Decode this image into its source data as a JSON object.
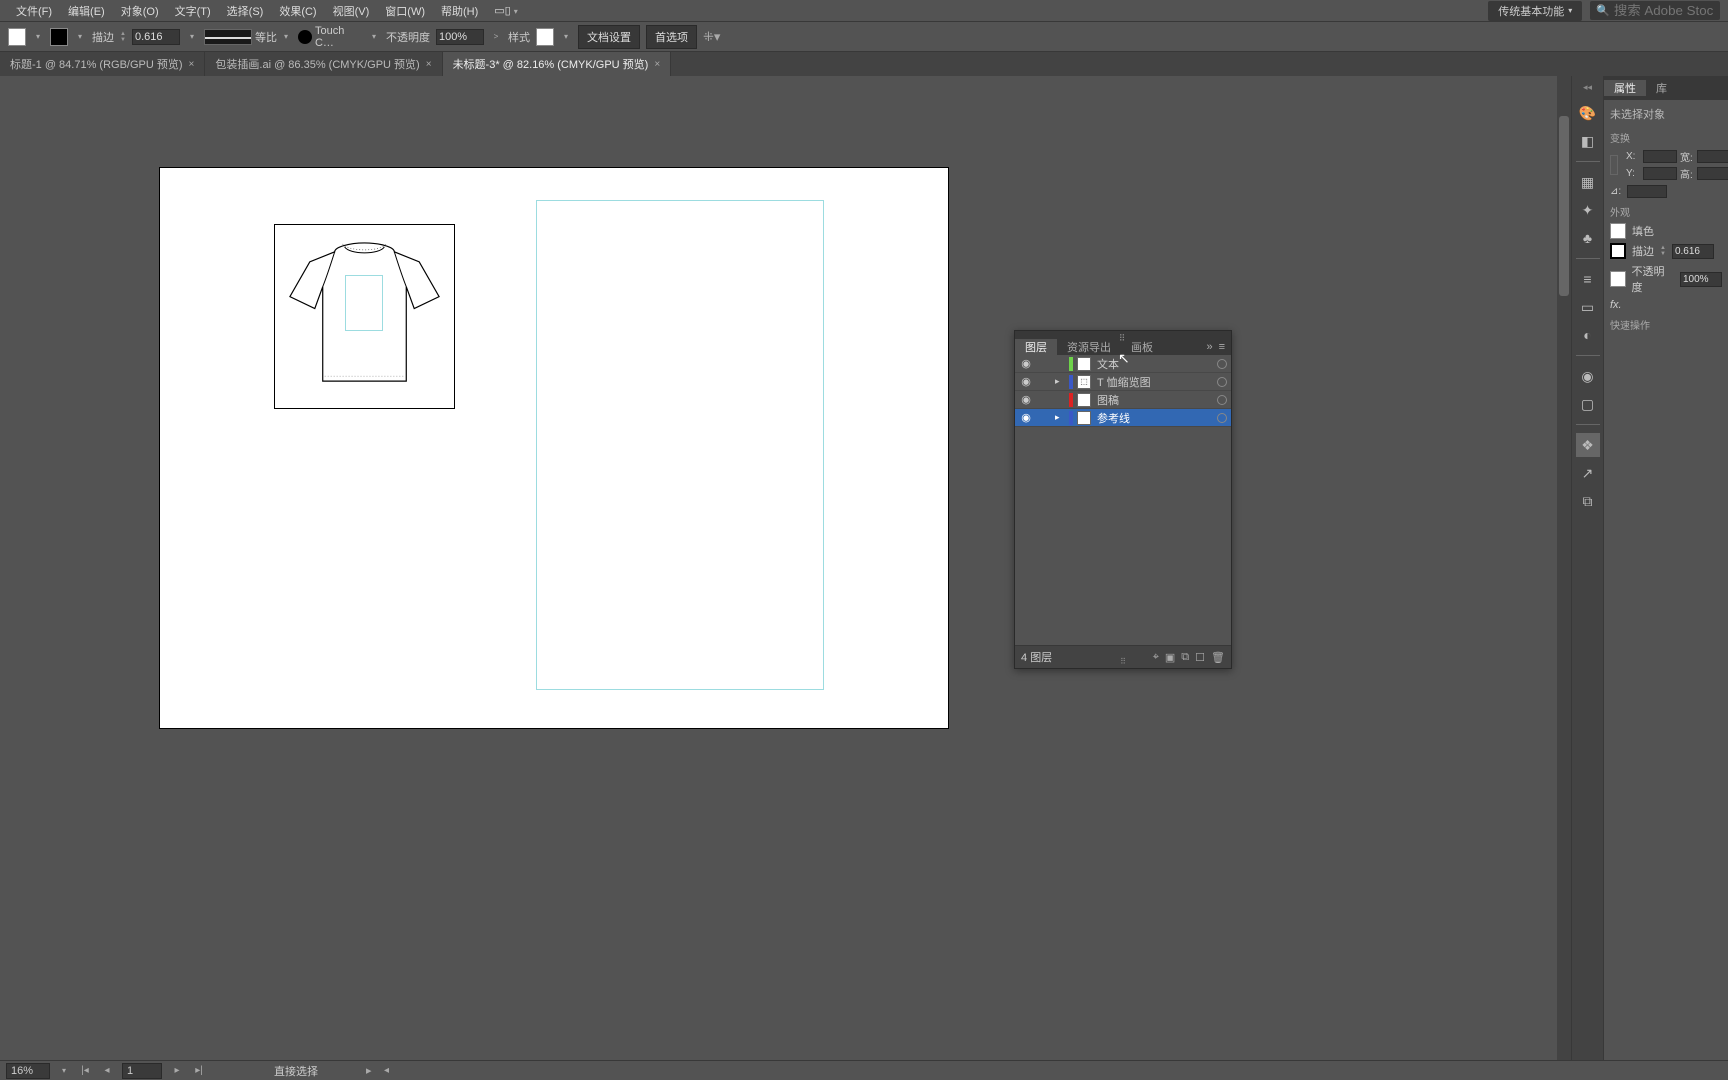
{
  "menu": {
    "items": [
      "文件(F)",
      "编辑(E)",
      "对象(O)",
      "文字(T)",
      "选择(S)",
      "效果(C)",
      "视图(V)",
      "窗口(W)",
      "帮助(H)"
    ],
    "workspace": "传统基本功能",
    "search_placeholder": "搜索 Adobe Stock"
  },
  "control": {
    "stroke_label": "描边",
    "stroke_value": "0.616 ",
    "stroke_profile": "等比",
    "brush_name": "Touch C…",
    "opacity_label": "不透明度",
    "opacity_value": "100%",
    "style_label": "样式",
    "doc_setup": "文档设置",
    "preferences": "首选项"
  },
  "tabs": [
    {
      "label": "标题-1 @ 84.71% (RGB/GPU 预览)",
      "active": false
    },
    {
      "label": "包装插画.ai @ 86.35% (CMYK/GPU 预览)",
      "active": false
    },
    {
      "label": "未标题-3* @ 82.16% (CMYK/GPU 预览)",
      "active": true
    }
  ],
  "layers_panel": {
    "tabs": [
      "图层",
      "资源导出",
      "画板"
    ],
    "active_tab": 0,
    "layers": [
      {
        "name": "文本",
        "color": "#6ed24a",
        "expandable": false,
        "selected": false
      },
      {
        "name": "T 恤缩览图",
        "color": "#3a58c6",
        "expandable": true,
        "selected": false,
        "thumb_text": "T"
      },
      {
        "name": "图稿",
        "color": "#d22",
        "expandable": false,
        "selected": false
      },
      {
        "name": "参考线",
        "color": "#3a58c6",
        "expandable": true,
        "selected": true
      }
    ],
    "footer_count": "4",
    "footer_label": "图层"
  },
  "properties": {
    "tabs": [
      "属性",
      "库"
    ],
    "no_selection": "未选择对象",
    "transform_title": "变换",
    "x_label": "X:",
    "y_label": "Y:",
    "w_label": "宽:",
    "h_label": "高:",
    "angle_label": "⊿:",
    "appearance_title": "外观",
    "fill_label": "填色",
    "stroke_label": "描边",
    "stroke_value": "0.616",
    "opacity_label": "不透明度",
    "opacity_value": "100%",
    "fx_label": "fx.",
    "quick_actions_title": "快速操作"
  },
  "status": {
    "zoom": "16%",
    "artboard_num": "1",
    "tool": "直接选择"
  }
}
